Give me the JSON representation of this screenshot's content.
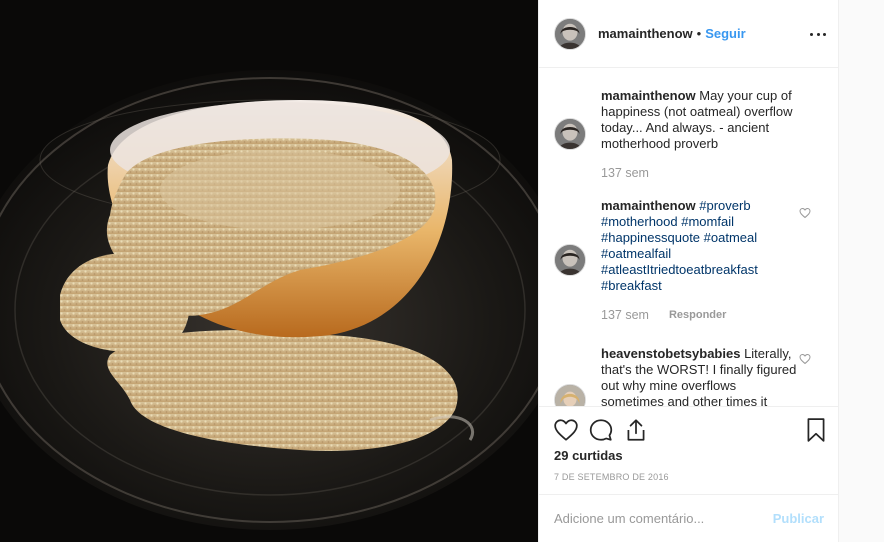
{
  "post": {
    "author": "mamainthenow",
    "separator": "•",
    "follow_label": "Seguir",
    "more_label": "More options"
  },
  "comments": [
    {
      "user": "mamainthenow",
      "text": " May your cup of happiness (not oatmeal) overflow today... And always. - ancient motherhood proverb",
      "time": "137 sem",
      "reply": ""
    },
    {
      "user": "mamainthenow",
      "tags": [
        "#proverb",
        "#motherhood",
        "#momfail",
        "#happinessquote",
        "#oatmeal",
        "#oatmealfail",
        "#atleastItriedtoeatbreakfast",
        "#breakfast"
      ],
      "time": "137 sem",
      "reply": "Responder"
    },
    {
      "user": "heavenstobetsybabies",
      "text": " Literally, that's the WORST! I finally figured out why mine overflows sometimes and other times it",
      "time": "",
      "reply": ""
    }
  ],
  "actions": {
    "likes": "29 curtidas",
    "date": "7 de setembro de 2016"
  },
  "composer": {
    "placeholder": "Adicione um comentário...",
    "publish_label": "Publicar"
  },
  "colors": {
    "link": "#3897f0",
    "hashtag": "#003569",
    "muted": "#999999",
    "publish_disabled": "#b2dffc"
  }
}
